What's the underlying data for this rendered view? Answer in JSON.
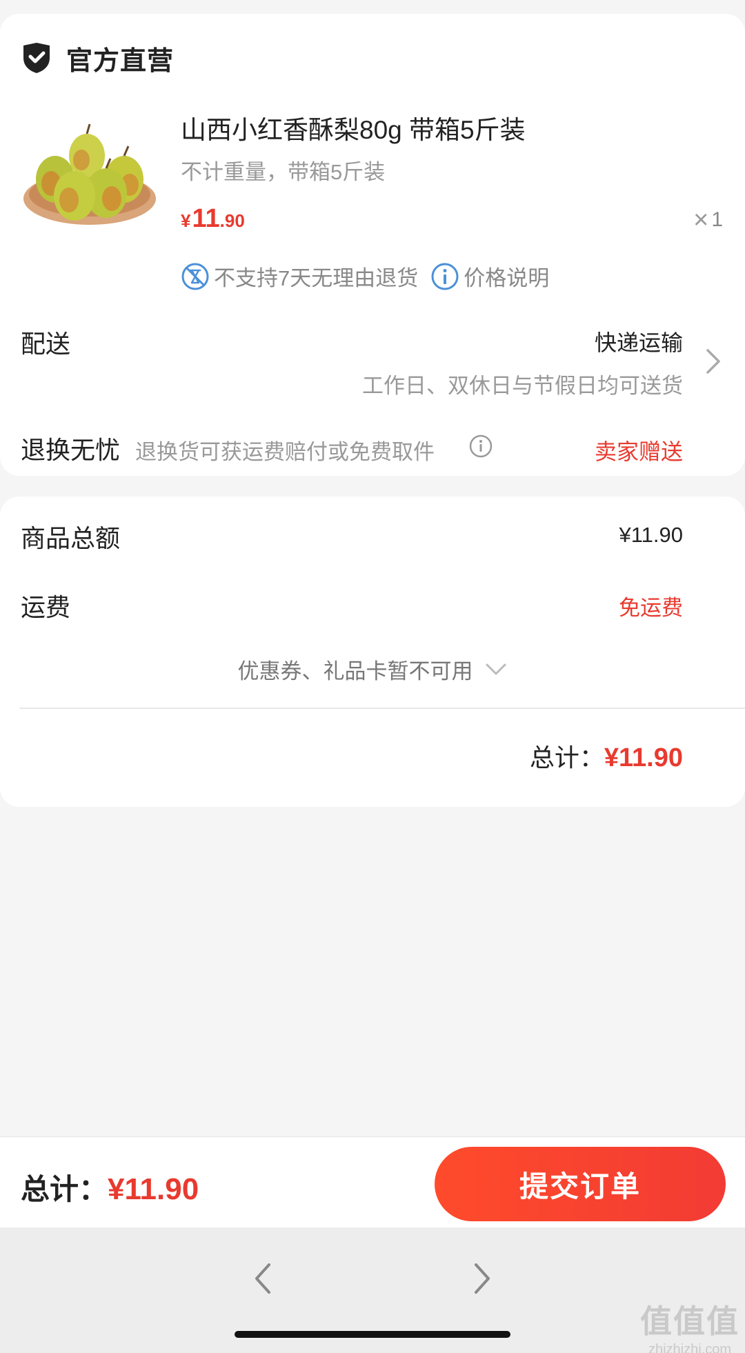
{
  "store": {
    "name": "官方直营",
    "icon": "shield-check-icon"
  },
  "product": {
    "title": "山西小红香酥梨80g 带箱5斤装",
    "spec": "不计重量，带箱5斤装",
    "price_currency": "¥",
    "price_int": "11",
    "price_dec": ".90",
    "quantity": "1",
    "tags": [
      {
        "icon": "no-return-icon",
        "label": "不支持7天无理由退货"
      },
      {
        "icon": "info-icon",
        "label": "价格说明"
      }
    ]
  },
  "delivery": {
    "label": "配送",
    "value": "快递运输",
    "sub": "工作日、双休日与节假日均可送货"
  },
  "returns": {
    "label": "退换无忧",
    "desc": "退换货可获运费赔付或免费取件",
    "value": "卖家赠送"
  },
  "summary": {
    "goods_label": "商品总额",
    "goods_value": "¥11.90",
    "shipping_label": "运费",
    "shipping_value": "免运费",
    "coupon_text": "优惠券、礼品卡暂不可用",
    "total_label": "总计：",
    "total_value": "¥11.90"
  },
  "bottom_bar": {
    "total_label": "总计：",
    "total_value": "¥11.90",
    "submit_label": "提交订单"
  },
  "watermark": {
    "big": "值值值",
    "small": "zhizhizhi.com"
  },
  "colors": {
    "accent_red": "#e83a2f",
    "button_red": "#ff4b2b",
    "info_blue": "#4a90d9"
  }
}
